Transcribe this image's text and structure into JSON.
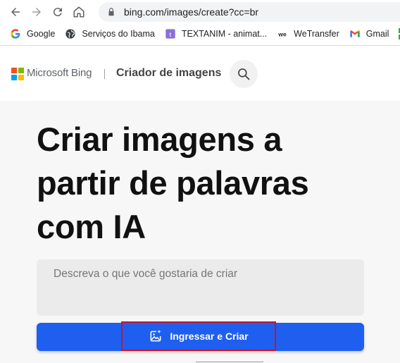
{
  "browser": {
    "url": "bing.com/images/create?cc=br",
    "bookmarks": [
      {
        "label": "Google",
        "icon": "google-icon"
      },
      {
        "label": "Serviços do Ibama",
        "icon": "globe-icon"
      },
      {
        "label": "TEXTANIM - animat...",
        "icon": "textanim-icon"
      },
      {
        "label": "WeTransfer",
        "icon": "wetransfer-icon"
      },
      {
        "label": "Gmail",
        "icon": "gmail-icon"
      }
    ]
  },
  "header": {
    "brand": "Microsoft Bing",
    "product": "Criador de imagens"
  },
  "hero": {
    "headline_line1": "Criar imagens a",
    "headline_line2": "partir de palavras",
    "headline_line3": "com IA",
    "prompt_placeholder": "Descreva o que você gostaria de criar",
    "create_label": "Ingressar e Criar"
  },
  "colors": {
    "accent": "#1f5ff0",
    "highlight_border": "#c3162c"
  }
}
